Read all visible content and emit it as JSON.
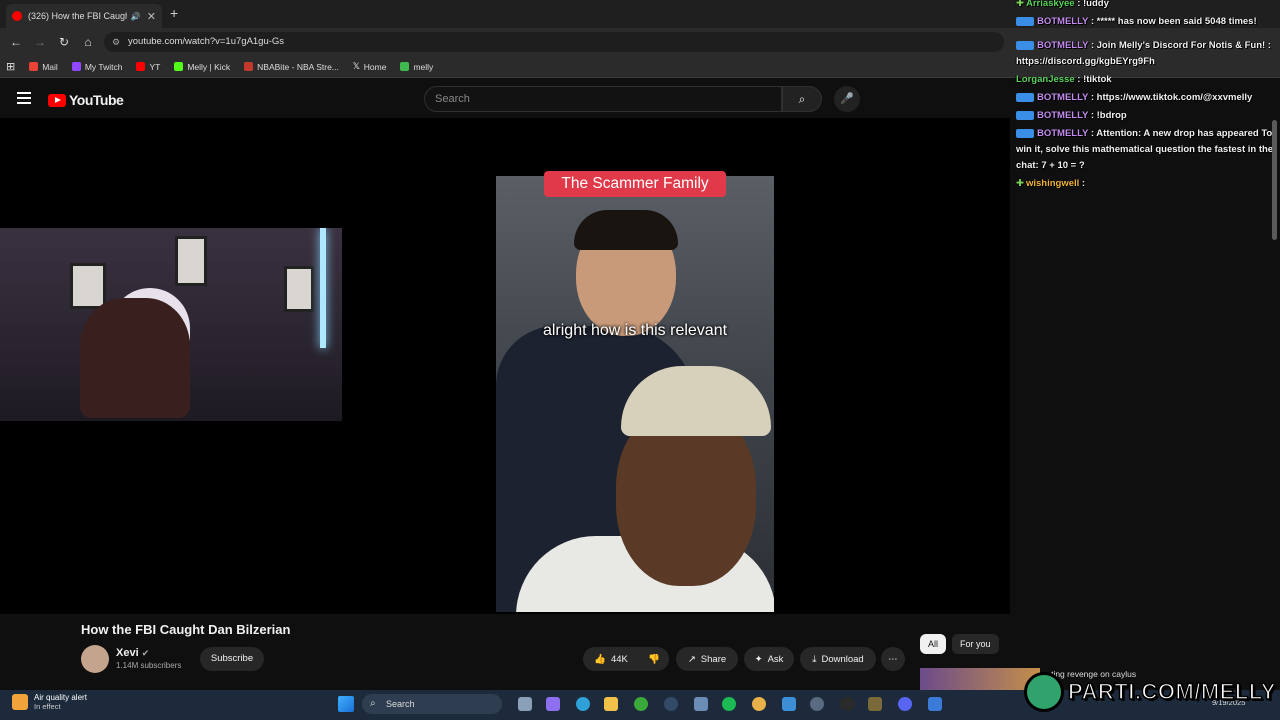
{
  "browser": {
    "tab_title": "(326) How the FBI Caught D",
    "url": "youtube.com/watch?v=1u7gA1gu-Gs",
    "bookmarks": [
      {
        "label": "Mail",
        "color": "#ea4335"
      },
      {
        "label": "My Twitch",
        "color": "#9146ff"
      },
      {
        "label": "YT",
        "color": "#ff0000"
      },
      {
        "label": "Melly | Kick",
        "color": "#53fc18"
      },
      {
        "label": "NBABite - NBA Stre...",
        "color": "#c0392b"
      },
      {
        "label": "Home",
        "color": "#ffffff"
      },
      {
        "label": "melly",
        "color": "#3fb950"
      }
    ]
  },
  "youtube": {
    "logo_text": "YouTube",
    "search_placeholder": "Search",
    "video": {
      "banner": "The Scammer Family",
      "caption": "alright how is this relevant",
      "title": "How the FBI Caught Dan Bilzerian",
      "channel": "Xevi",
      "subscribers": "1.14M subscribers",
      "subscribe_label": "Subscribe",
      "likes": "44K",
      "share_label": "Share",
      "ask_label": "Ask",
      "download_label": "Download"
    },
    "chips": [
      "All",
      "For you"
    ],
    "recommended_title": "...ting revenge on caylus"
  },
  "chat": [
    {
      "user": "Arriaskyee",
      "text": ": !uddy",
      "color": "#5ad35a",
      "badge": "plus"
    },
    {
      "user": "BOTMELLY",
      "text": ": ***** has now been said 5048 times!",
      "color": "#c38cf0",
      "badge": "bot"
    },
    {
      "user": "BOTMELLY",
      "text": ": Join Melly's Discord For Notis & Fun! : https://discord.gg/kgbEYrg9Fh",
      "color": "#c38cf0",
      "badge": "bot"
    },
    {
      "user": "LorganJesse",
      "text": ": !tiktok",
      "color": "#5ad35a",
      "badge": "none"
    },
    {
      "user": "BOTMELLY",
      "text": ": https://www.tiktok.com/@xxvmelly",
      "color": "#c38cf0",
      "badge": "bot"
    },
    {
      "user": "BOTMELLY",
      "text": ": !bdrop",
      "color": "#c38cf0",
      "badge": "bot"
    },
    {
      "user": "BOTMELLY",
      "text": ": Attention: A new drop has appeared To win it, solve this mathematical question the fastest in the chat: 7 + 10 = ?",
      "color": "#c38cf0",
      "badge": "bot"
    },
    {
      "user": "wishingwell",
      "text": ":",
      "color": "#f0b23a",
      "badge": "plus"
    }
  ],
  "taskbar": {
    "weather_title": "Air quality alert",
    "weather_sub": "In effect",
    "search_label": "Search",
    "date": "9/19/2025"
  },
  "watermark": "PARTI.COM/MELLY"
}
